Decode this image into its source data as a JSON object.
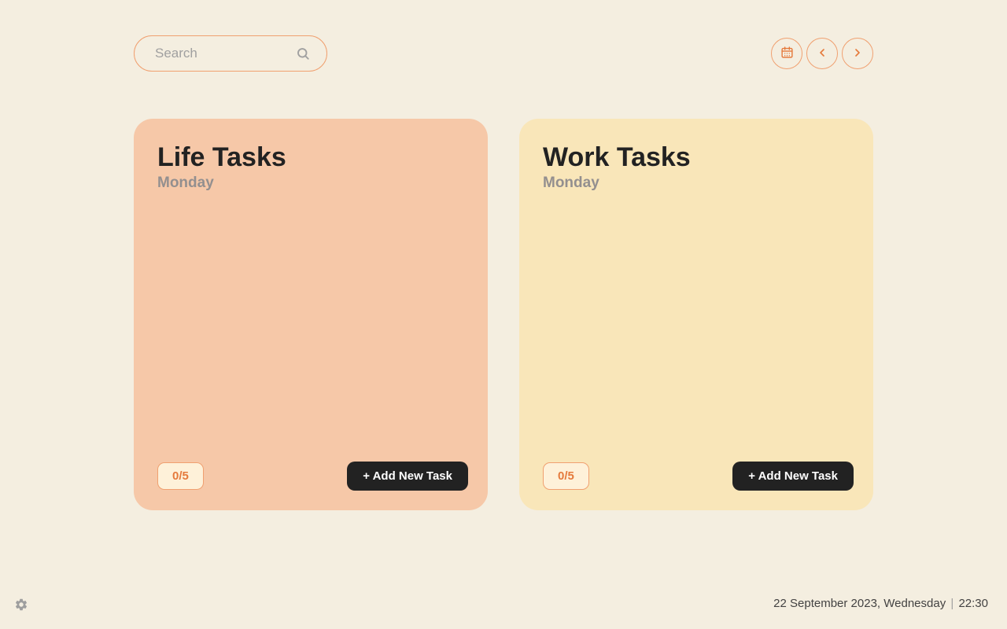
{
  "search": {
    "placeholder": "Search"
  },
  "cards": {
    "life": {
      "title": "Life Tasks",
      "day": "Monday",
      "counter": "0/5",
      "add_label": "+ Add New Task"
    },
    "work": {
      "title": "Work Tasks",
      "day": "Monday",
      "counter": "0/5",
      "add_label": "+ Add New Task"
    }
  },
  "footer": {
    "date": "22 September 2023, Wednesday",
    "time": "22:30"
  }
}
